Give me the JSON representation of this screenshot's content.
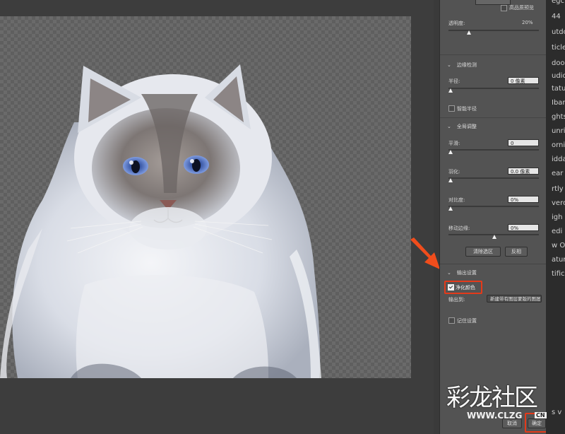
{
  "panel": {
    "hq_preview_label": "高品质预览",
    "opacity": {
      "label": "透明度:",
      "value": "20%",
      "level": 0.2
    },
    "edge_detection": {
      "header": "边缘检测",
      "radius": {
        "label": "半径:",
        "value": "0 像素",
        "level": 0.0
      },
      "smart_radius_label": "智能半径"
    },
    "global_refinements": {
      "header": "全局调整",
      "smooth": {
        "label": "平滑:",
        "value": "0"
      },
      "feather": {
        "label": "羽化:",
        "value": "0.0 像素"
      },
      "contrast": {
        "label": "对比度:",
        "value": "0%"
      },
      "shift_edge": {
        "label": "移动边缘:",
        "value": "0%"
      },
      "clear_selection_label": "清除选区",
      "invert_label": "反相"
    },
    "output_settings": {
      "header": "输出设置",
      "decontaminate_label": "净化颜色",
      "output_to_label": "输出到:",
      "output_to_value": "新建带有图层蒙版的图层",
      "remember_label": "记住设置"
    },
    "cancel_label": "取消",
    "ok_label": "确定"
  },
  "right_strip": [
    "egc",
    "44",
    "utdo",
    "ticles",
    "doo",
    "udio",
    "tatu",
    "Iban",
    "ghts",
    "unri",
    "orni",
    "idda",
    "ear",
    "rtly",
    "verc",
    "igh",
    "edi",
    "w O",
    "atur",
    "tific",
    "s v"
  ],
  "watermark": {
    "title": "彩龙社区",
    "url": "WWW.CLZG",
    "cn": "CN"
  },
  "colors": {
    "highlight": "#e43a1a",
    "panel_bg": "#535353",
    "checker": "#6a6a6a"
  }
}
